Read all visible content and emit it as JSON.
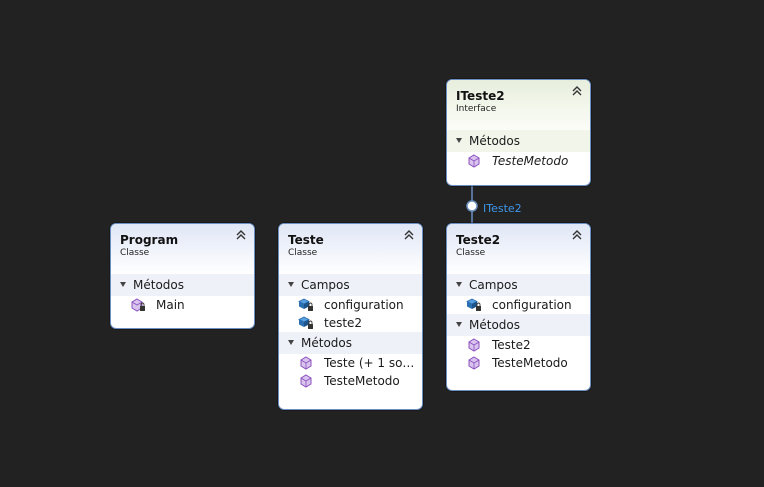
{
  "interface": {
    "name": "ITeste2",
    "kind": "Interface",
    "methods_label": "Métodos",
    "methods": [
      "TesteMetodo"
    ]
  },
  "program": {
    "name": "Program",
    "kind": "Classe",
    "methods_label": "Métodos",
    "methods": [
      "Main"
    ]
  },
  "teste": {
    "name": "Teste",
    "kind": "Classe",
    "fields_label": "Campos",
    "fields": [
      "configuration",
      "teste2"
    ],
    "methods_label": "Métodos",
    "methods": [
      "Teste (+ 1 sobr…",
      "TesteMetodo"
    ]
  },
  "teste2": {
    "name": "Teste2",
    "kind": "Classe",
    "fields_label": "Campos",
    "fields": [
      "configuration"
    ],
    "methods_label": "Métodos",
    "methods": [
      "Teste2",
      "TesteMetodo"
    ]
  },
  "connector": {
    "label": "ITeste2"
  },
  "colors": {
    "background": "#222223",
    "border": "#6b8fc2",
    "connector": "#3e97e8",
    "method_icon": "#8a4fbf",
    "field_icon": "#2a6fb0"
  }
}
